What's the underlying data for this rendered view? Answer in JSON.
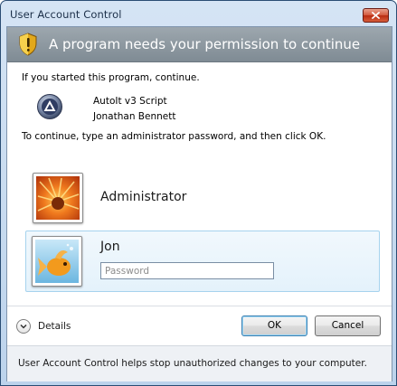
{
  "window": {
    "title": "User Account Control"
  },
  "banner": {
    "heading": "A program needs your permission to continue",
    "icon": "uac-shield-icon"
  },
  "body": {
    "started_text": "If you started this program, continue.",
    "program_name": "AutoIt v3 Script",
    "publisher": "Jonathan Bennett",
    "instruction": "To continue, type an administrator password, and then click OK."
  },
  "users": [
    {
      "name": "Administrator",
      "selected": false
    },
    {
      "name": "Jon",
      "selected": true,
      "password_placeholder": "Password",
      "password_value": ""
    }
  ],
  "buttons": {
    "details": "Details",
    "ok": "OK",
    "cancel": "Cancel"
  },
  "footer": {
    "text": "User Account Control helps stop unauthorized changes to your computer."
  },
  "colors": {
    "banner": "#8a959e",
    "selected_tile": "#e6f3fc",
    "selected_border": "#a6d3ee",
    "close_button": "#c9452a"
  }
}
